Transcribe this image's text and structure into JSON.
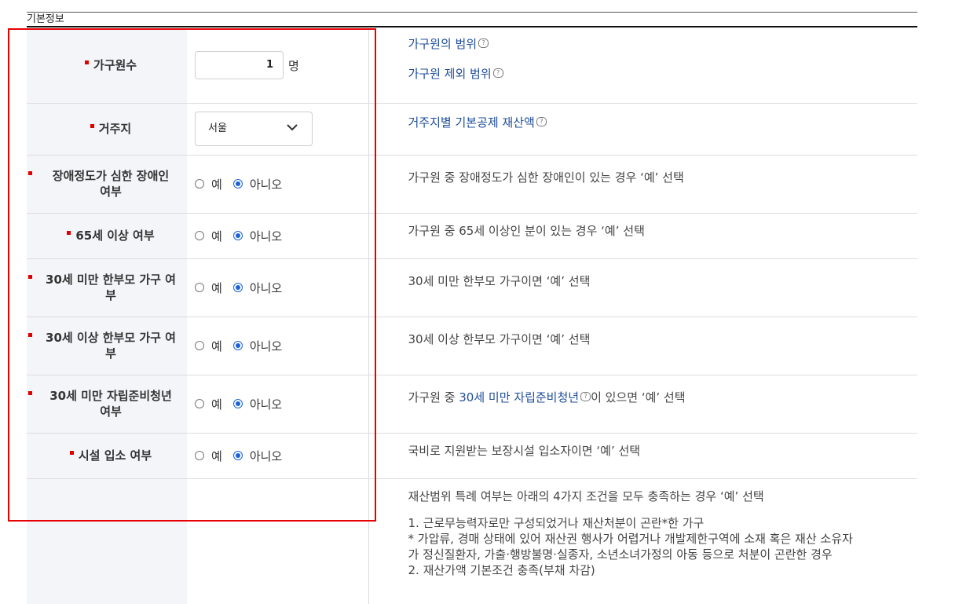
{
  "section": {
    "title": "기본정보"
  },
  "rows": {
    "household": {
      "label": "가구원수",
      "value": "1",
      "unit": "명",
      "links": [
        "가구원의 범위",
        "가구원 제외 범위"
      ]
    },
    "residence": {
      "label": "거주지",
      "selected": "서울",
      "link": "거주지별 기본공제 재산액"
    },
    "disabled": {
      "label_line1": "장애정도가 심한 장애인",
      "label_line2": "여부",
      "desc": "가구원 중 장애정도가 심한 장애인이 있는 경우 ‘예’ 선택"
    },
    "over65": {
      "label": "65세 이상 여부",
      "desc": "가구원 중 65세 이상인 분이 있는 경우 ‘예’ 선택"
    },
    "singleUnder30": {
      "label_line1": "30세 미만 한부모 가구 여",
      "label_line2": "부",
      "desc": "30세 미만 한부모 가구이면 ‘예’ 선택"
    },
    "singleOver30": {
      "label_line1": "30세 이상 한부모 가구 여",
      "label_line2": "부",
      "desc": "30세 이상 한부모 가구이면 ‘예’ 선택"
    },
    "youth": {
      "label_line1": "30세 미만 자립준비청년",
      "label_line2": "여부",
      "desc_prefix": "가구원 중 ",
      "desc_link": "30세 미만 자립준비청년",
      "desc_suffix": "이 있으면 ‘예’ 선택"
    },
    "facility": {
      "label": "시설 입소 여부",
      "desc": "국비로 지원받는 보장시설 입소자이면 ‘예’ 선택"
    },
    "special": {
      "desc": "재산범위 특례 여부는 아래의 4가지 조건을 모두 충족하는 경우 ‘예’ 선택",
      "lines": [
        "1. 근로무능력자로만 구성되었거나 재산처분이 곤란*한 가구",
        "* 가압류, 경매 상태에 있어 재산권 행사가 어렵거나 개발제한구역에 소재 혹은 재산 소유자",
        "가 정신질환자, 가출·행방불명·실종자, 소년소녀가정의 아동 등으로 처분이 곤란한 경우",
        "2. 재산가액 기본조건 충족(부채 차감)"
      ]
    }
  },
  "radio": {
    "yes": "예",
    "no": "아니오"
  },
  "colors": {
    "required": "#e00000",
    "link": "#1f4e9c",
    "radio": "#1a62d6",
    "frame": "#e60000"
  }
}
